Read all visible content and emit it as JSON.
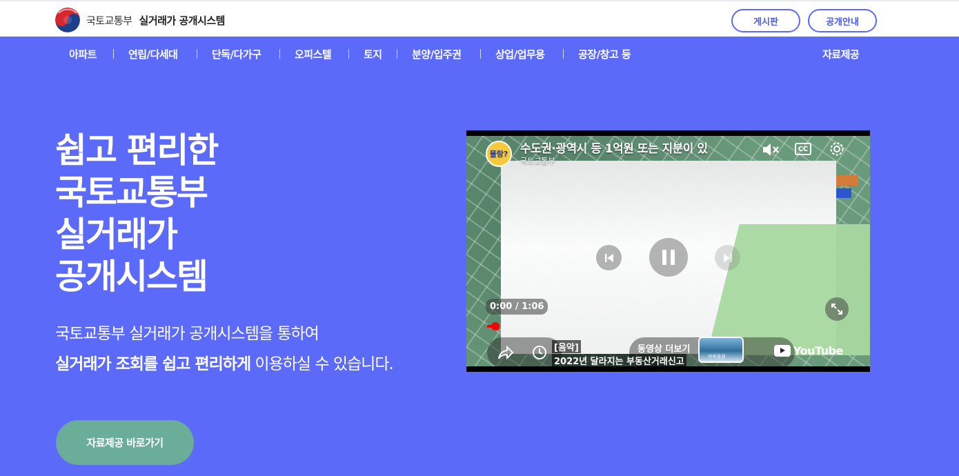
{
  "header": {
    "ministry": "국토교통부",
    "site_title": "실거래가 공개시스템",
    "board_button": "게시판",
    "guide_button": "공개안내"
  },
  "nav": {
    "items": [
      "아파트",
      "연립/다세대",
      "단독/다가구",
      "오피스텔",
      "토지",
      "분양/입주권",
      "상업/업무용",
      "공장/창고 등"
    ],
    "data_provision": "자료제공"
  },
  "hero": {
    "title_lines": [
      "쉽고 편리한",
      "국토교통부",
      "실거래가",
      "공개시스템"
    ],
    "desc_line1": "국토교통부 실거래가 공개시스템을 통하여",
    "desc_line2_bold": "실거래가 조회를 쉽고 편리하게",
    "desc_line2_rest": " 이용하실 수 있습니다.",
    "cta": "자료제공 바로가기"
  },
  "video": {
    "title": "수도권·광역시 등 1억원 또는 지분이 있",
    "channel": "국토교통부",
    "channel_badge": "물랑?",
    "cc": "CC",
    "time": "0:00 / 1:06",
    "progress": 0.0,
    "caption_line1": "[음악]",
    "caption_line2": "2022년 달라지는 부동산거래신고",
    "more_videos": "동영상 더보기",
    "thumb_caption": "카피응원",
    "youtube": "YouTube",
    "colors": {
      "page_bg": "#5b6af8",
      "cta_bg": "#6aae9a",
      "progress_red": "#ff0000"
    },
    "icons": [
      "mute-icon",
      "cc-icon",
      "settings-gear-icon",
      "previous-icon",
      "pause-icon",
      "next-icon",
      "fullscreen-icon",
      "share-icon",
      "watch-later-clock-icon",
      "youtube-logo-icon"
    ]
  }
}
